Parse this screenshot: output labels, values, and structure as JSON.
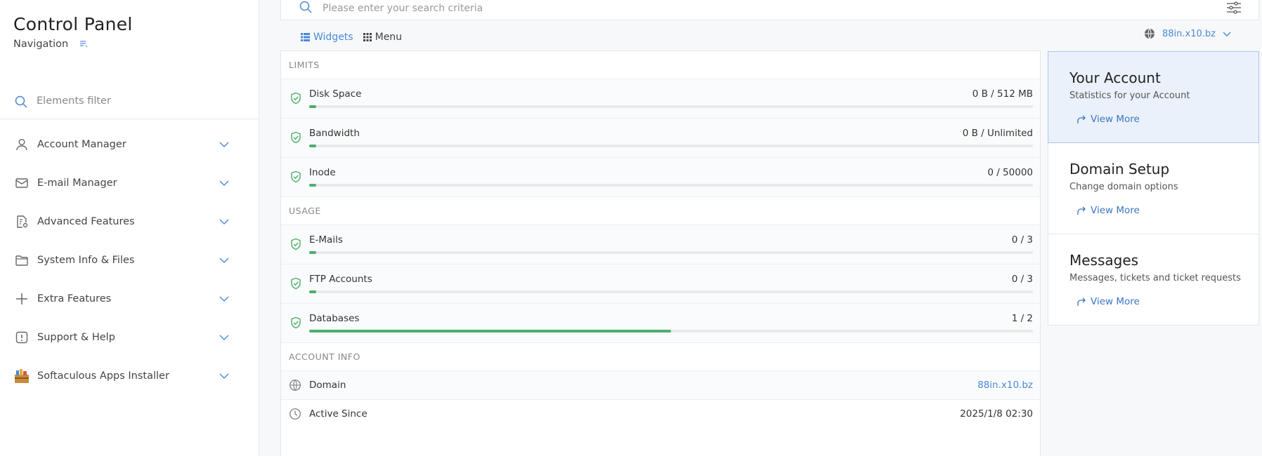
{
  "sidebar": {
    "title": "Control Panel",
    "subtitle": "Navigation",
    "filter_placeholder": "Elements filter",
    "items": [
      {
        "label": "Account Manager",
        "icon": "user-icon"
      },
      {
        "label": "E-mail Manager",
        "icon": "envelope-icon"
      },
      {
        "label": "Advanced Features",
        "icon": "document-gear-icon"
      },
      {
        "label": "System Info & Files",
        "icon": "folder-icon"
      },
      {
        "label": "Extra Features",
        "icon": "plus-icon"
      },
      {
        "label": "Support & Help",
        "icon": "exclamation-icon"
      },
      {
        "label": "Softaculous Apps Installer",
        "icon": "softaculous-icon"
      }
    ]
  },
  "search": {
    "placeholder": "Please enter your search criteria"
  },
  "view_tabs": {
    "widgets": "Widgets",
    "menu": "Menu"
  },
  "domain_selector": {
    "value": "88in.x10.bz"
  },
  "limits": {
    "section_label": "LIMITS",
    "rows": [
      {
        "name": "Disk Space",
        "value": "0 B / 512 MB",
        "fill_percent": 1
      },
      {
        "name": "Bandwidth",
        "value": "0 B / Unlimited",
        "fill_percent": 1
      },
      {
        "name": "Inode",
        "value": "0 / 50000",
        "fill_percent": 1
      }
    ]
  },
  "usage": {
    "section_label": "USAGE",
    "rows": [
      {
        "name": "E-Mails",
        "value": "0 / 3",
        "fill_percent": 1
      },
      {
        "name": "FTP Accounts",
        "value": "0 / 3",
        "fill_percent": 1
      },
      {
        "name": "Databases",
        "value": "1 / 2",
        "fill_percent": 50
      }
    ]
  },
  "account_info": {
    "section_label": "ACCOUNT INFO",
    "domain_label": "Domain",
    "domain_value": "88in.x10.bz",
    "active_label": "Active Since",
    "active_value": "2025/1/8 02:30"
  },
  "cards": [
    {
      "title": "Your Account",
      "description": "Statistics for your Account",
      "link": "View More"
    },
    {
      "title": "Domain Setup",
      "description": "Change domain options",
      "link": "View More"
    },
    {
      "title": "Messages",
      "description": "Messages, tickets and ticket requests",
      "link": "View More"
    }
  ],
  "colors": {
    "accent": "#4a88d9",
    "progress": "#4caf6a",
    "active_card": "#eaf1fa"
  }
}
